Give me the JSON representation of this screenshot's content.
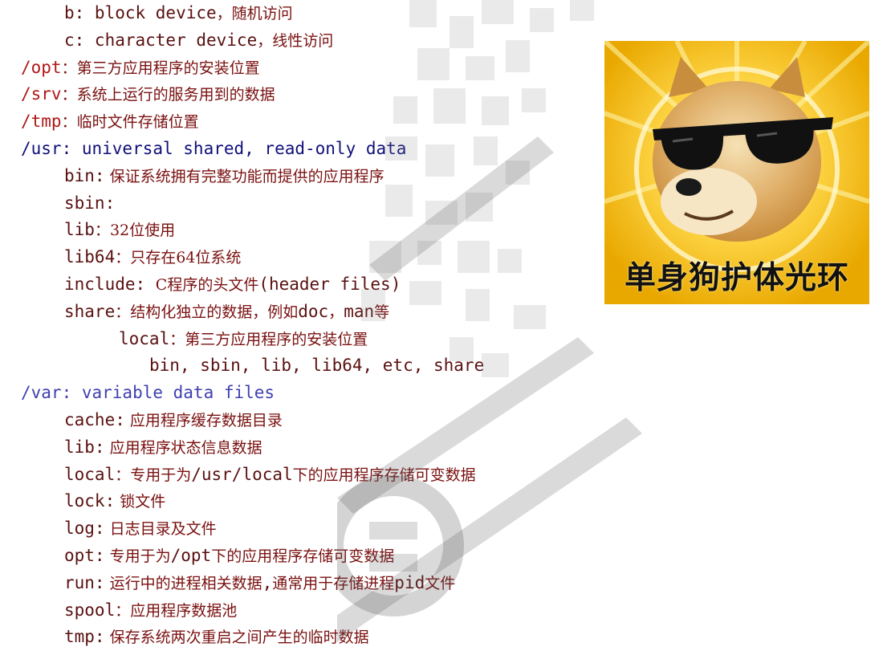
{
  "lines": [
    {
      "indent": 1,
      "parts": [
        {
          "t": "b: block device",
          "cls": "mono c-dark"
        },
        {
          "t": "，随机访问",
          "cls": "cjk c-maroon"
        }
      ]
    },
    {
      "indent": 1,
      "parts": [
        {
          "t": "c: character device",
          "cls": "mono c-dark"
        },
        {
          "t": "，线性访问",
          "cls": "cjk c-maroon"
        }
      ]
    },
    {
      "indent": 0,
      "parts": [
        {
          "t": "/opt",
          "cls": "mono c-red"
        },
        {
          "t": "：第三方应用程序的安装位置",
          "cls": "cjk c-maroon"
        }
      ]
    },
    {
      "indent": 0,
      "parts": [
        {
          "t": "/srv",
          "cls": "mono c-red"
        },
        {
          "t": "：系统上运行的服务用到的数据",
          "cls": "cjk c-maroon"
        }
      ]
    },
    {
      "indent": 0,
      "parts": [
        {
          "t": "/tmp",
          "cls": "mono c-red"
        },
        {
          "t": "：临时文件存储位置",
          "cls": "cjk c-maroon"
        }
      ]
    },
    {
      "indent": 0,
      "parts": [
        {
          "t": "/usr: universal shared, read-only data",
          "cls": "mono c-navy"
        }
      ]
    },
    {
      "indent": 1,
      "parts": [
        {
          "t": "bin:",
          "cls": "mono c-dark"
        },
        {
          "t": " 保证系统拥有完整功能而提供的应用程序",
          "cls": "cjk c-maroon"
        }
      ]
    },
    {
      "indent": 1,
      "parts": [
        {
          "t": "sbin:",
          "cls": "mono c-dark"
        }
      ]
    },
    {
      "indent": 1,
      "parts": [
        {
          "t": "lib",
          "cls": "mono c-dark"
        },
        {
          "t": "：32位使用",
          "cls": "cjk c-maroon"
        }
      ]
    },
    {
      "indent": 1,
      "parts": [
        {
          "t": "lib64",
          "cls": "mono c-dark"
        },
        {
          "t": "：只存在64位系统",
          "cls": "cjk c-maroon"
        }
      ]
    },
    {
      "indent": 1,
      "parts": [
        {
          "t": "include: ",
          "cls": "mono c-dark"
        },
        {
          "t": "C程序的头文件",
          "cls": "cjk c-maroon"
        },
        {
          "t": "(header files)",
          "cls": "mono c-dark"
        }
      ]
    },
    {
      "indent": 1,
      "parts": [
        {
          "t": "share",
          "cls": "mono c-dark"
        },
        {
          "t": "：结构化独立的数据，例如",
          "cls": "cjk c-maroon"
        },
        {
          "t": "doc",
          "cls": "mono c-dark"
        },
        {
          "t": "，",
          "cls": "cjk c-maroon"
        },
        {
          "t": "man",
          "cls": "mono c-dark"
        },
        {
          "t": "等",
          "cls": "cjk c-maroon"
        }
      ]
    },
    {
      "indent": 2,
      "parts": [
        {
          "t": "local",
          "cls": "mono c-dark"
        },
        {
          "t": "：第三方应用程序的安装位置",
          "cls": "cjk c-maroon"
        }
      ]
    },
    {
      "indent": 3,
      "parts": [
        {
          "t": "bin, sbin, lib, lib64, etc, share",
          "cls": "mono c-dark"
        }
      ]
    },
    {
      "indent": 0,
      "parts": [
        {
          "t": "/var: variable data files",
          "cls": "mono c-blue"
        }
      ]
    },
    {
      "indent": 1,
      "parts": [
        {
          "t": "cache:",
          "cls": "mono c-dark"
        },
        {
          "t": " 应用程序缓存数据目录",
          "cls": "cjk c-maroon"
        }
      ]
    },
    {
      "indent": 1,
      "parts": [
        {
          "t": "lib:",
          "cls": "mono c-dark"
        },
        {
          "t": " 应用程序状态信息数据",
          "cls": "cjk c-maroon"
        }
      ]
    },
    {
      "indent": 1,
      "parts": [
        {
          "t": "local",
          "cls": "mono c-dark"
        },
        {
          "t": "：专用于为",
          "cls": "cjk c-maroon"
        },
        {
          "t": "/usr/local",
          "cls": "mono c-dark"
        },
        {
          "t": "下的应用程序存储可变数据",
          "cls": "cjk c-maroon"
        }
      ]
    },
    {
      "indent": 1,
      "parts": [
        {
          "t": "lock:",
          "cls": "mono c-dark"
        },
        {
          "t": " 锁文件",
          "cls": "cjk c-maroon"
        }
      ]
    },
    {
      "indent": 1,
      "parts": [
        {
          "t": "log:",
          "cls": "mono c-dark"
        },
        {
          "t": " 日志目录及文件",
          "cls": "cjk c-maroon"
        }
      ]
    },
    {
      "indent": 1,
      "parts": [
        {
          "t": "opt:",
          "cls": "mono c-dark"
        },
        {
          "t": " 专用于为",
          "cls": "cjk c-maroon"
        },
        {
          "t": "/opt",
          "cls": "mono c-dark"
        },
        {
          "t": "下的应用程序存储可变数据",
          "cls": "cjk c-maroon"
        }
      ]
    },
    {
      "indent": 1,
      "parts": [
        {
          "t": "run:",
          "cls": "mono c-dark"
        },
        {
          "t": " 运行中的进程相关数据",
          "cls": "cjk c-maroon"
        },
        {
          "t": ",",
          "cls": "mono c-dark"
        },
        {
          "t": "通常用于存储进程",
          "cls": "cjk c-maroon"
        },
        {
          "t": "pid",
          "cls": "mono c-dark"
        },
        {
          "t": "文件",
          "cls": "cjk c-maroon"
        }
      ]
    },
    {
      "indent": 1,
      "parts": [
        {
          "t": "spool",
          "cls": "mono c-dark"
        },
        {
          "t": "：应用程序数据池",
          "cls": "cjk c-maroon"
        }
      ]
    },
    {
      "indent": 1,
      "parts": [
        {
          "t": "tmp:",
          "cls": "mono c-dark"
        },
        {
          "t": " 保存系统两次重启之间产生的临时数据",
          "cls": "cjk c-maroon"
        }
      ]
    }
  ],
  "meme": {
    "caption": "单身狗护体光环",
    "icon": "doge-sunglasses-icon",
    "colors": {
      "glow": "#f5c400",
      "rays": "#ffe98a",
      "fur": "#d9a35a",
      "fur_light": "#f3dcae",
      "lens": "#111111"
    }
  },
  "watermark": {
    "icon": "pixelated-watermark-icon"
  }
}
